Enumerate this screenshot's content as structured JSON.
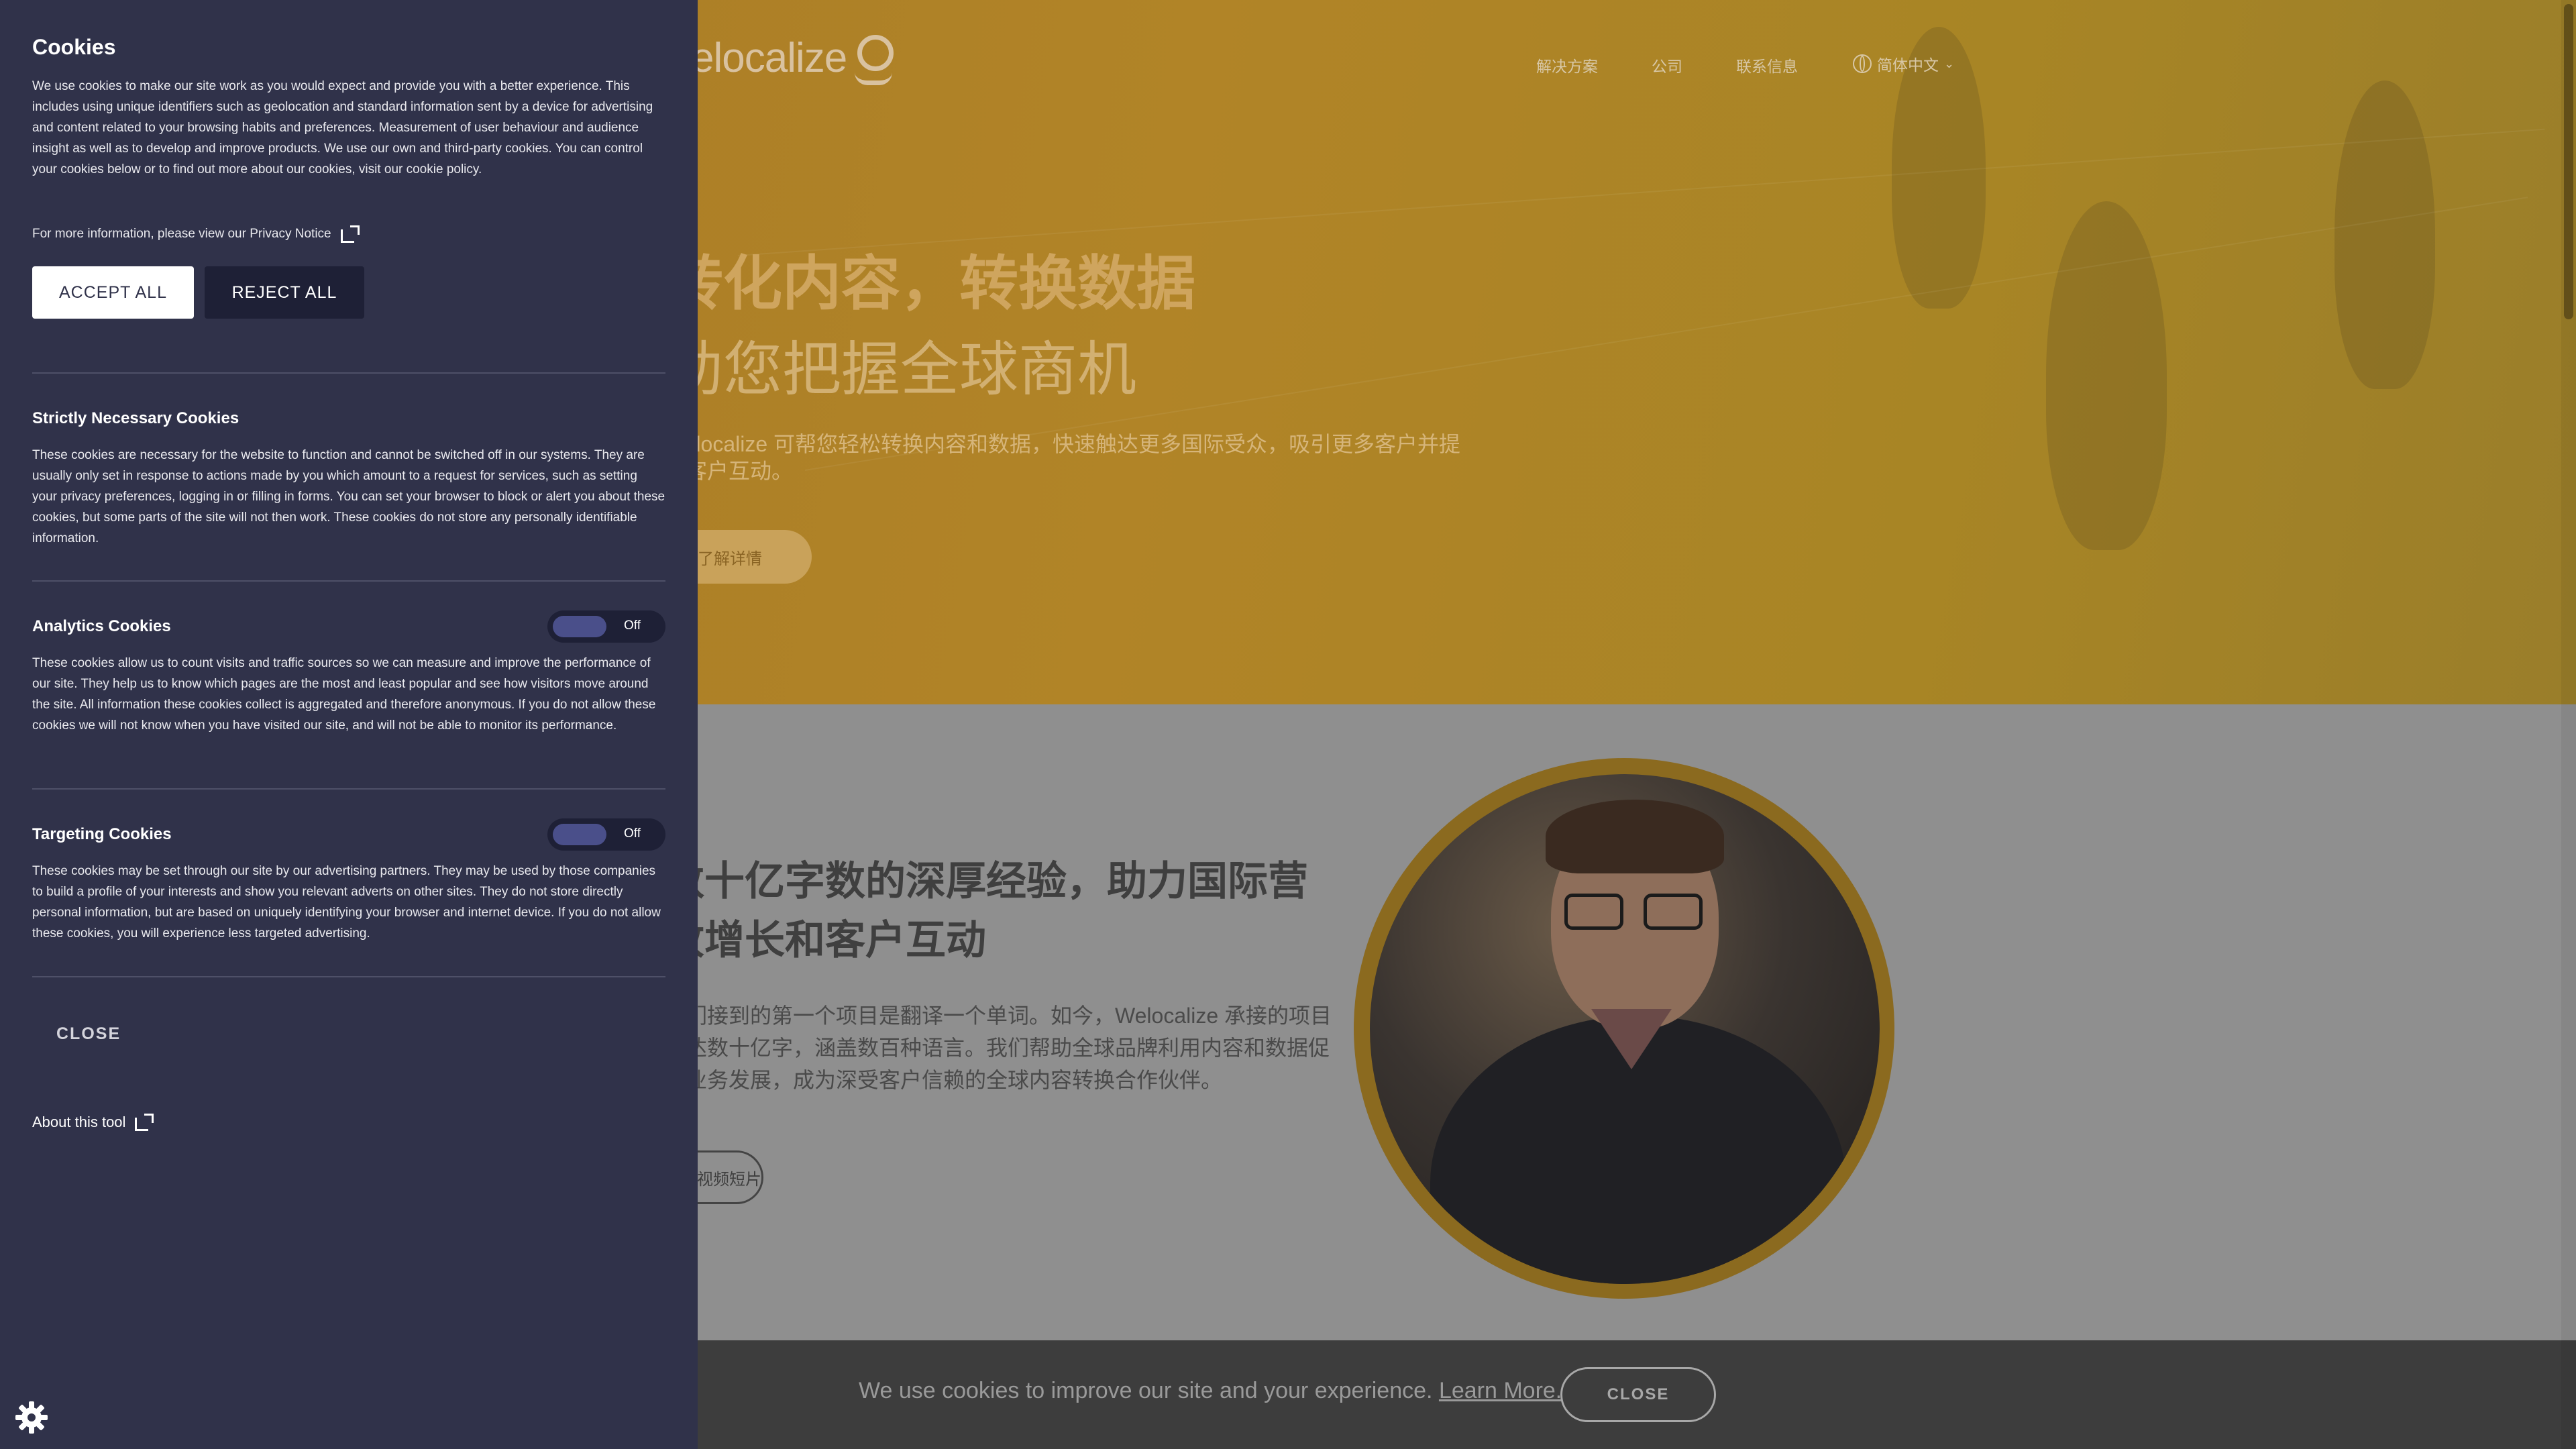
{
  "site": {
    "logo_text": "elocalize",
    "nav": [
      "解决方案",
      "公司",
      "联系信息"
    ],
    "language": "简体中文",
    "hero": {
      "headline": "转化内容，转换数据",
      "subheadline": "助您把握全球商机",
      "body": "Welocalize 可帮您轻松转换内容和数据，快速触达更多国际受众，吸引更多客户并提升客户互动。",
      "button": "了解详情"
    },
    "section2": {
      "headline": "数十亿字数的深厚经验，助力国际营收增长和客户互动",
      "body": "我们接到的第一个项目是翻译一个单词。如今，Welocalize 承接的项目已达数十亿字，涵盖数百种语言。我们帮助全球品牌利用内容和数据促进业务发展，成为深受客户信赖的全球内容转换合作伙伴。",
      "button": "视频短片"
    },
    "cookie_bar": {
      "text": "We use cookies to improve our site and your experience.",
      "link": "Learn More.",
      "close": "CLOSE"
    }
  },
  "panel": {
    "title": "Cookies",
    "intro": "We use cookies to make our site work as you would expect and provide you with a better experience. This includes using unique identifiers such as geolocation and standard information sent by a device for advertising and content related to your browsing habits and preferences. Measurement of user behaviour and audience insight as well as to develop and improve products. We use our own and third-party cookies. You can control your cookies below or to find out more about our cookies, visit our cookie policy.",
    "more_info": "For more information, please view our Privacy Notice",
    "accept_all": "ACCEPT ALL",
    "reject_all": "REJECT ALL",
    "sections": [
      {
        "title": "Strictly Necessary Cookies",
        "text": "These cookies are necessary for the website to function and cannot be switched off in our systems. They are usually only set in response to actions made by you which amount to a request for services, such as setting your privacy preferences, logging in or filling in forms. You can set your browser to block or alert you about these cookies, but some parts of the site will not then work. These cookies do not store any personally identifiable information."
      },
      {
        "title": "Analytics Cookies",
        "toggle": "Off",
        "text": "These cookies allow us to count visits and traffic sources so we can measure and improve the performance of our site. They help us to know which pages are the most and least popular and see how visitors move around the site. All information these cookies collect is aggregated and therefore anonymous. If you do not allow these cookies we will not know when you have visited our site, and will not be able to monitor its performance."
      },
      {
        "title": "Targeting Cookies",
        "toggle": "Off",
        "text": "These cookies may be set through our site by our advertising partners. They may be used by those companies to build a profile of your interests and show you relevant adverts on other sites. They do not store directly personal information, but are based on uniquely identifying your browser and internet device. If you do not allow these cookies, you will experience less targeted advertising."
      }
    ],
    "close": "CLOSE",
    "about": "About this tool"
  },
  "colors": {
    "panel_bg": "#30324a",
    "hero_gold": "#b18427",
    "toggle_knob": "#4a4f8a"
  }
}
